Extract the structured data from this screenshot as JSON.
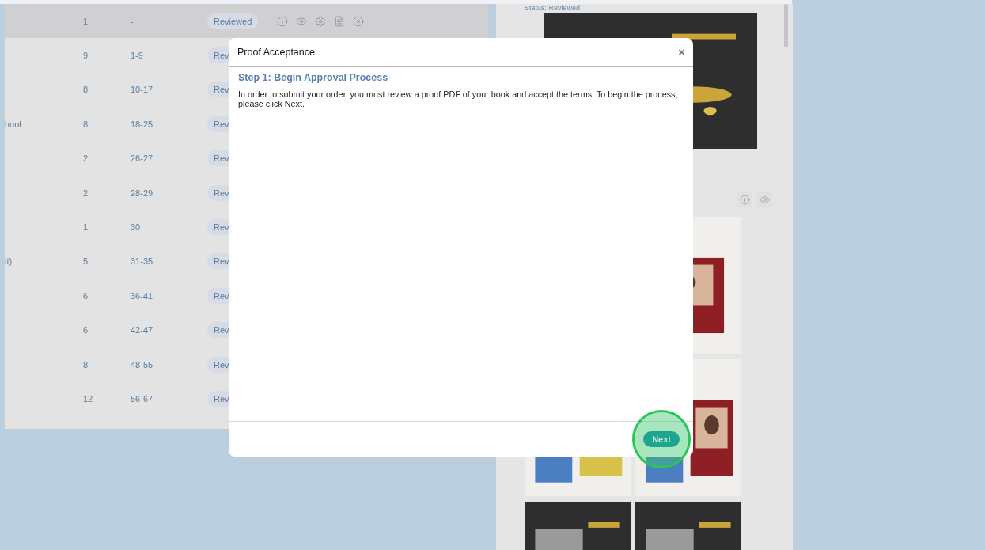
{
  "left_table": {
    "rows": [
      {
        "count": "1",
        "pages": "-",
        "status": "Reviewed",
        "selected": true
      },
      {
        "count": "9",
        "pages": "1-9",
        "status": "Rev",
        "selected": false
      },
      {
        "count": "8",
        "pages": "10-17",
        "status": "Rev",
        "selected": false
      },
      {
        "name": "hool",
        "count": "8",
        "pages": "18-25",
        "status": "Rev",
        "selected": false
      },
      {
        "count": "2",
        "pages": "26-27",
        "status": "Rev",
        "selected": false
      },
      {
        "count": "2",
        "pages": "28-29",
        "status": "Rev",
        "selected": false
      },
      {
        "count": "1",
        "pages": "30",
        "status": "Rev",
        "selected": false
      },
      {
        "name": "it)",
        "count": "5",
        "pages": "31-35",
        "status": "Rev",
        "selected": false
      },
      {
        "count": "6",
        "pages": "36-41",
        "status": "Rev",
        "selected": false
      },
      {
        "count": "6",
        "pages": "42-47",
        "status": "Rev",
        "selected": false
      },
      {
        "count": "8",
        "pages": "48-55",
        "status": "Rev",
        "selected": false
      },
      {
        "count": "12",
        "pages": "56-67",
        "status": "Rev",
        "selected": false
      }
    ]
  },
  "right_panel": {
    "status_label": "Status:",
    "status_value": "Reviewed"
  },
  "dialog": {
    "title": "Proof Acceptance",
    "close": "×",
    "step_title": "Step 1: Begin Approval Process",
    "message": "In order to submit your order, you must review a proof PDF of your book and accept the terms. To begin the process, please click Next.",
    "buttons": [
      {
        "label": "Next",
        "highlighted": true
      }
    ]
  }
}
